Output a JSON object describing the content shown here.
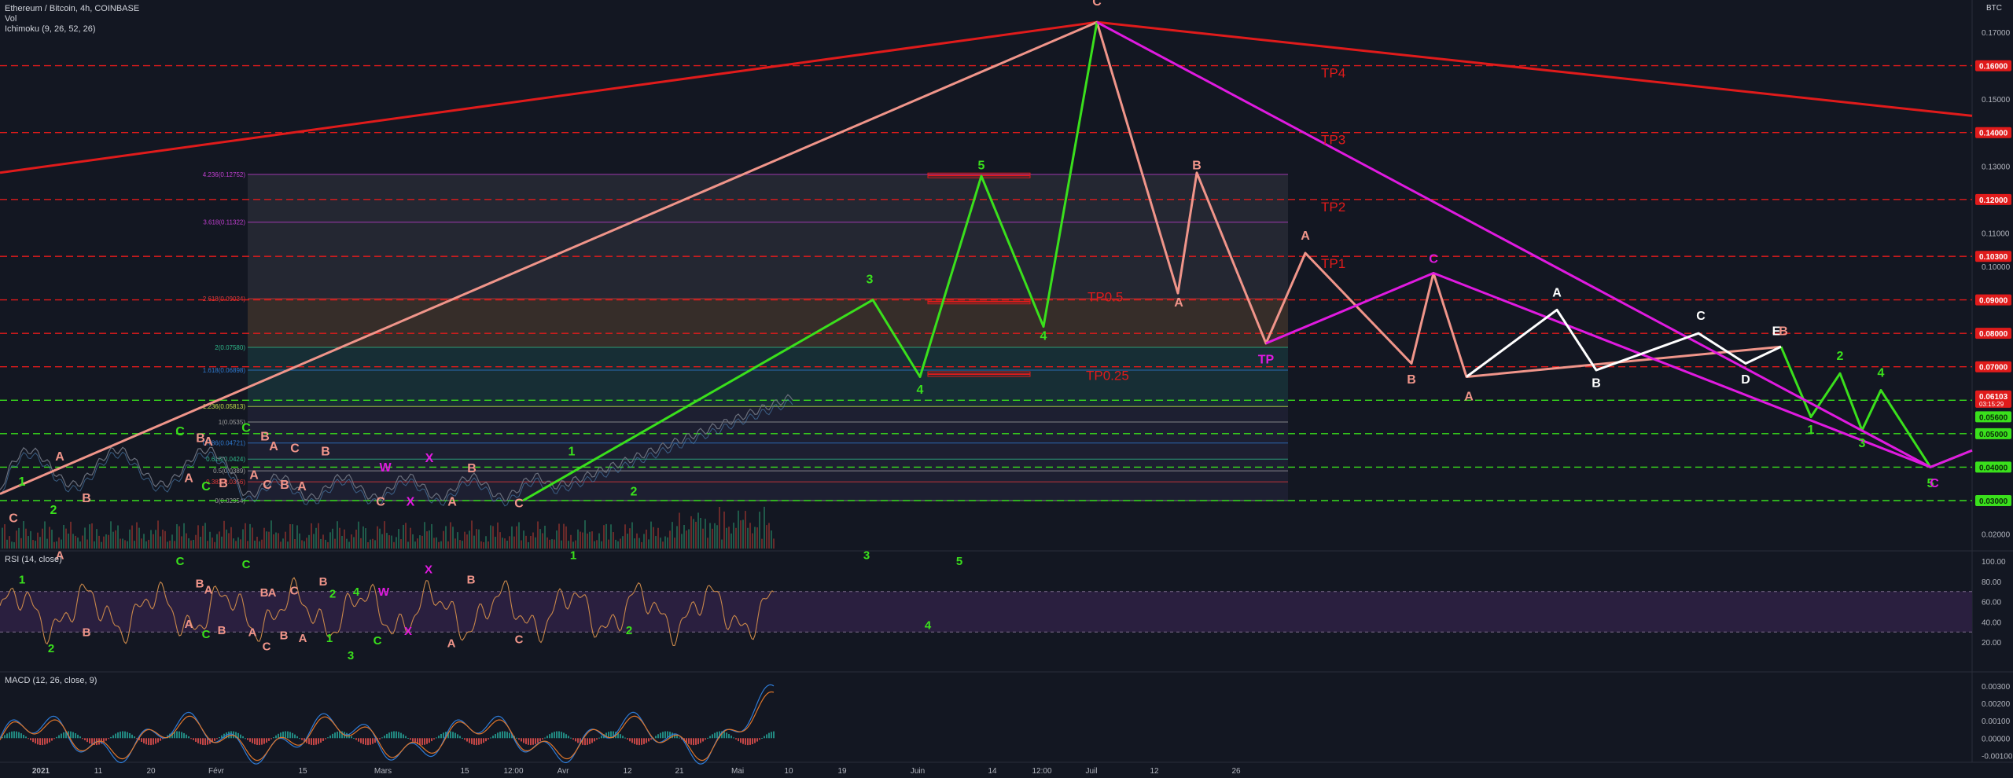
{
  "header": {
    "symbol_line": "Ethereum / Bitcoin, 4h, COINBASE",
    "vol_label": "Vol",
    "ichimoku_label": "Ichimoku (9, 26, 52, 26)",
    "rsi_label": "RSI (14, close)",
    "macd_label": "MACD (12, 26, close, 9)",
    "currency": "BTC"
  },
  "colors": {
    "background": "#131722",
    "red": "#e01b1b",
    "salmon": "#f0958a",
    "green": "#3ae01c",
    "magenta": "#e01ae0",
    "white": "#ffffff",
    "orange_rsi": "#c8874a",
    "macd_blue": "#2e7bd6",
    "macd_orange": "#e0762a"
  },
  "chart_data": {
    "type": "line",
    "title": "Ethereum / Bitcoin, 4h, COINBASE",
    "y_axis": {
      "min": 0.015,
      "max": 0.18,
      "ticks": [
        {
          "v": 0.17,
          "t": "0.17000"
        },
        {
          "v": 0.15,
          "t": "0.15000"
        },
        {
          "v": 0.13,
          "t": "0.13000"
        },
        {
          "v": 0.11,
          "t": "0.11000"
        },
        {
          "v": 0.1,
          "t": "0.10000"
        },
        {
          "v": 0.06,
          "t": "0.06000"
        },
        {
          "v": 0.03,
          "t": "0.03000"
        },
        {
          "v": 0.02,
          "t": "0.02000"
        }
      ],
      "highlighted": [
        {
          "v": 0.16,
          "t": "0.16000",
          "color": "red"
        },
        {
          "v": 0.14,
          "t": "0.14000",
          "color": "red"
        },
        {
          "v": 0.12,
          "t": "0.12000",
          "color": "red"
        },
        {
          "v": 0.103,
          "t": "0.10300",
          "color": "red"
        },
        {
          "v": 0.09,
          "t": "0.09000",
          "color": "red"
        },
        {
          "v": 0.08,
          "t": "0.08000",
          "color": "red"
        },
        {
          "v": 0.07,
          "t": "0.07000",
          "color": "red"
        },
        {
          "v": 0.05,
          "t": "0.05000",
          "color": "green"
        },
        {
          "v": 0.04,
          "t": "0.04000",
          "color": "green"
        },
        {
          "v": 0.03,
          "t": "0.03000",
          "color": "green"
        }
      ],
      "last_price": {
        "v": 0.06103,
        "t": "0.06103",
        "sub": "03:15:29"
      },
      "green_price": {
        "v": 0.056,
        "t": "0.05600"
      }
    },
    "x_ticks": [
      "2021",
      "11",
      "20",
      "Févr",
      "15",
      "Mars",
      "15",
      "12:00",
      "Avr",
      "12",
      "21",
      "Mai",
      "10",
      "19",
      "Juin",
      "14",
      "12:00",
      "Juil",
      "12",
      "26"
    ],
    "horizontal_levels": [
      {
        "v": 0.16,
        "color": "red",
        "style": "dashed"
      },
      {
        "v": 0.14,
        "color": "red",
        "style": "dashed"
      },
      {
        "v": 0.12,
        "color": "red",
        "style": "dashed"
      },
      {
        "v": 0.103,
        "color": "red",
        "style": "dashed"
      },
      {
        "v": 0.09,
        "color": "red",
        "style": "dashed"
      },
      {
        "v": 0.08,
        "color": "red",
        "style": "dashed"
      },
      {
        "v": 0.07,
        "color": "red",
        "style": "dashed"
      },
      {
        "v": 0.06,
        "color": "green",
        "style": "dashed"
      },
      {
        "v": 0.05,
        "color": "green",
        "style": "dashed"
      },
      {
        "v": 0.04,
        "color": "green",
        "style": "dashed"
      },
      {
        "v": 0.03,
        "color": "green",
        "style": "dashed"
      }
    ],
    "fib_levels": [
      {
        "v": 0.12752,
        "t": "4.236(0.12752)",
        "color": "#c03fd0"
      },
      {
        "v": 0.11322,
        "t": "3.618(0.11322)",
        "color": "#c03fd0"
      },
      {
        "v": 0.09034,
        "t": "2.618(0.09034)",
        "color": "#e03a3a"
      },
      {
        "v": 0.0758,
        "t": "2(0.07580)",
        "color": "#2fb88a"
      },
      {
        "v": 0.06898,
        "t": "1.618(0.06898)",
        "color": "#2f7ad0"
      },
      {
        "v": 0.05813,
        "t": "1.236(0.05813)",
        "color": "#c0e04a"
      },
      {
        "v": 0.0535,
        "t": "1(0.0535)",
        "color": "#9e9e9e"
      },
      {
        "v": 0.04721,
        "t": "0.786(0.04721)",
        "color": "#2f7ad0"
      },
      {
        "v": 0.0424,
        "t": "0.618(0.0424)",
        "color": "#2fb88a"
      },
      {
        "v": 0.0389,
        "t": "0.5(0.0389)",
        "color": "#9e9e9e"
      },
      {
        "v": 0.0356,
        "t": "0.382(0.0356)",
        "color": "#e03a3a"
      },
      {
        "v": 0.03,
        "t": "0(0.02954)",
        "color": "#9e9e9e"
      }
    ],
    "tp_labels": [
      {
        "t": "TP4",
        "v": 0.1565
      },
      {
        "t": "TP3",
        "v": 0.1365
      },
      {
        "t": "TP2",
        "v": 0.1165
      },
      {
        "t": "TP1",
        "v": 0.0995
      },
      {
        "t": "TP0.5",
        "v": 0.0895
      },
      {
        "t": "TP0.25",
        "v": 0.066
      }
    ],
    "series": [
      {
        "color": "red",
        "points": [
          [
            0,
            0.128
          ],
          [
            1395,
            0.173
          ],
          [
            2508,
            0.145
          ]
        ]
      },
      {
        "color": "salmon",
        "points": [
          [
            0,
            0.032
          ],
          [
            1395,
            0.173
          ],
          [
            1498,
            0.092
          ],
          [
            1522,
            0.128
          ],
          [
            1610,
            0.077
          ],
          [
            1660,
            0.104
          ],
          [
            1795,
            0.071
          ],
          [
            1823,
            0.098
          ],
          [
            1865,
            0.067
          ],
          [
            2265,
            0.076
          ]
        ]
      },
      {
        "color": "green",
        "points": [
          [
            665,
            0.03
          ],
          [
            1110,
            0.09
          ],
          [
            1170,
            0.067
          ],
          [
            1248,
            0.127
          ],
          [
            1327,
            0.082
          ],
          [
            1395,
            0.173
          ]
        ]
      },
      {
        "color": "green",
        "points": [
          [
            2265,
            0.076
          ],
          [
            2303,
            0.055
          ],
          [
            2340,
            0.068
          ],
          [
            2368,
            0.051
          ],
          [
            2392,
            0.063
          ],
          [
            2455,
            0.04
          ],
          [
            2508,
            0.045
          ]
        ]
      },
      {
        "color": "magenta",
        "points": [
          [
            1395,
            0.173
          ],
          [
            2455,
            0.04
          ],
          [
            2508,
            0.045
          ]
        ]
      },
      {
        "color": "magenta",
        "points": [
          [
            1610,
            0.077
          ],
          [
            1823,
            0.098
          ],
          [
            2455,
            0.04
          ]
        ]
      },
      {
        "color": "white",
        "points": [
          [
            1865,
            0.067
          ],
          [
            1980,
            0.087
          ],
          [
            2030,
            0.069
          ],
          [
            2160,
            0.08
          ],
          [
            2220,
            0.071
          ],
          [
            2265,
            0.076
          ]
        ]
      }
    ],
    "wave_labels": [
      {
        "t": "C",
        "x": 1395,
        "v": 0.178,
        "color": "salmon"
      },
      {
        "t": "5",
        "x": 1248,
        "v": 0.129,
        "color": "green"
      },
      {
        "t": "B",
        "x": 1522,
        "v": 0.129,
        "color": "salmon"
      },
      {
        "t": "A",
        "x": 1499,
        "v": 0.088,
        "color": "salmon"
      },
      {
        "t": "3",
        "x": 1106,
        "v": 0.095,
        "color": "green"
      },
      {
        "t": "4",
        "x": 1327,
        "v": 0.078,
        "color": "green"
      },
      {
        "t": "4",
        "x": 1170,
        "v": 0.062,
        "color": "green"
      },
      {
        "t": "TP",
        "x": 1610,
        "v": 0.071,
        "color": "magenta"
      },
      {
        "t": "A",
        "x": 1660,
        "v": 0.108,
        "color": "salmon"
      },
      {
        "t": "C",
        "x": 1823,
        "v": 0.101,
        "color": "magenta"
      },
      {
        "t": "B",
        "x": 1795,
        "v": 0.065,
        "color": "salmon"
      },
      {
        "t": "A",
        "x": 1868,
        "v": 0.06,
        "color": "salmon"
      },
      {
        "t": "A",
        "x": 1980,
        "v": 0.091,
        "color": "white"
      },
      {
        "t": "B",
        "x": 2030,
        "v": 0.064,
        "color": "white"
      },
      {
        "t": "C",
        "x": 2163,
        "v": 0.084,
        "color": "white"
      },
      {
        "t": "D",
        "x": 2220,
        "v": 0.065,
        "color": "white"
      },
      {
        "t": "E",
        "x": 2259,
        "v": 0.0795,
        "color": "white"
      },
      {
        "t": "B",
        "x": 2268,
        "v": 0.0795,
        "color": "salmon"
      },
      {
        "t": "2",
        "x": 2340,
        "v": 0.072,
        "color": "green"
      },
      {
        "t": "4",
        "x": 2392,
        "v": 0.067,
        "color": "green"
      },
      {
        "t": "1",
        "x": 2303,
        "v": 0.05,
        "color": "green"
      },
      {
        "t": "3",
        "x": 2368,
        "v": 0.046,
        "color": "green"
      },
      {
        "t": "5",
        "x": 2455,
        "v": 0.034,
        "color": "green"
      },
      {
        "t": "C",
        "x": 2460,
        "v": 0.034,
        "color": "magenta"
      },
      {
        "t": "1",
        "x": 28,
        "v": 0.0345,
        "color": "green"
      },
      {
        "t": "2",
        "x": 68,
        "v": 0.026,
        "color": "green"
      },
      {
        "t": "A",
        "x": 76,
        "v": 0.042,
        "color": "salmon"
      },
      {
        "t": "B",
        "x": 110,
        "v": 0.0295,
        "color": "salmon"
      },
      {
        "t": "C",
        "x": 17,
        "v": 0.0235,
        "color": "salmon"
      },
      {
        "t": "C",
        "x": 229,
        "v": 0.0495,
        "color": "green"
      },
      {
        "t": "B",
        "x": 255,
        "v": 0.0475,
        "color": "salmon"
      },
      {
        "t": "A",
        "x": 265,
        "v": 0.0465,
        "color": "salmon"
      },
      {
        "t": "A",
        "x": 240,
        "v": 0.0355,
        "color": "salmon"
      },
      {
        "t": "B",
        "x": 284,
        "v": 0.034,
        "color": "salmon"
      },
      {
        "t": "C",
        "x": 262,
        "v": 0.033,
        "color": "green"
      },
      {
        "t": "C",
        "x": 313,
        "v": 0.0505,
        "color": "green"
      },
      {
        "t": "B",
        "x": 337,
        "v": 0.048,
        "color": "salmon"
      },
      {
        "t": "A",
        "x": 348,
        "v": 0.045,
        "color": "salmon"
      },
      {
        "t": "C",
        "x": 375,
        "v": 0.0445,
        "color": "salmon"
      },
      {
        "t": "B",
        "x": 414,
        "v": 0.0435,
        "color": "salmon"
      },
      {
        "t": "A",
        "x": 323,
        "v": 0.0365,
        "color": "salmon"
      },
      {
        "t": "C",
        "x": 340,
        "v": 0.0335,
        "color": "salmon"
      },
      {
        "t": "B",
        "x": 362,
        "v": 0.0335,
        "color": "salmon"
      },
      {
        "t": "A",
        "x": 384,
        "v": 0.033,
        "color": "salmon"
      },
      {
        "t": "W",
        "x": 490,
        "v": 0.0387,
        "color": "magenta"
      },
      {
        "t": "X",
        "x": 546,
        "v": 0.0415,
        "color": "magenta"
      },
      {
        "t": "C",
        "x": 484,
        "v": 0.0285,
        "color": "salmon"
      },
      {
        "t": "X",
        "x": 522,
        "v": 0.0285,
        "color": "magenta"
      },
      {
        "t": "A",
        "x": 575,
        "v": 0.0285,
        "color": "salmon"
      },
      {
        "t": "B",
        "x": 600,
        "v": 0.0385,
        "color": "salmon"
      },
      {
        "t": "C",
        "x": 660,
        "v": 0.028,
        "color": "salmon"
      },
      {
        "t": "1",
        "x": 727,
        "v": 0.0435,
        "color": "green"
      },
      {
        "t": "2",
        "x": 806,
        "v": 0.0315,
        "color": "green"
      }
    ],
    "rsi": {
      "ylim": [
        0,
        100
      ],
      "ticks": [
        {
          "v": 100,
          "t": "100.00"
        },
        {
          "v": 80,
          "t": "80.00"
        },
        {
          "v": 60,
          "t": "60.00"
        },
        {
          "v": 40,
          "t": "40.00"
        },
        {
          "v": 20,
          "t": "20.00"
        }
      ],
      "band": [
        30,
        70
      ],
      "labels": [
        {
          "t": "A",
          "x": 76,
          "v": 102,
          "color": "salmon"
        },
        {
          "t": "1",
          "x": 28,
          "v": 78,
          "color": "green"
        },
        {
          "t": "2",
          "x": 65,
          "v": 10,
          "color": "green"
        },
        {
          "t": "B",
          "x": 110,
          "v": 26,
          "color": "salmon"
        },
        {
          "t": "C",
          "x": 229,
          "v": 96,
          "color": "green"
        },
        {
          "t": "C",
          "x": 313,
          "v": 93,
          "color": "green"
        },
        {
          "t": "B",
          "x": 254,
          "v": 74,
          "color": "salmon"
        },
        {
          "t": "A",
          "x": 265,
          "v": 68,
          "color": "salmon"
        },
        {
          "t": "A",
          "x": 240,
          "v": 34,
          "color": "salmon"
        },
        {
          "t": "C",
          "x": 262,
          "v": 24,
          "color": "green"
        },
        {
          "t": "B",
          "x": 282,
          "v": 28,
          "color": "salmon"
        },
        {
          "t": "B",
          "x": 336,
          "v": 65,
          "color": "salmon"
        },
        {
          "t": "A",
          "x": 346,
          "v": 65,
          "color": "salmon"
        },
        {
          "t": "C",
          "x": 374,
          "v": 67,
          "color": "salmon"
        },
        {
          "t": "B",
          "x": 411,
          "v": 76,
          "color": "salmon"
        },
        {
          "t": "2",
          "x": 423,
          "v": 64,
          "color": "green"
        },
        {
          "t": "4",
          "x": 453,
          "v": 66,
          "color": "green"
        },
        {
          "t": "A",
          "x": 321,
          "v": 26,
          "color": "salmon"
        },
        {
          "t": "C",
          "x": 339,
          "v": 12,
          "color": "salmon"
        },
        {
          "t": "B",
          "x": 361,
          "v": 23,
          "color": "salmon"
        },
        {
          "t": "A",
          "x": 385,
          "v": 20,
          "color": "salmon"
        },
        {
          "t": "1",
          "x": 419,
          "v": 20,
          "color": "green"
        },
        {
          "t": "3",
          "x": 446,
          "v": 3,
          "color": "green"
        },
        {
          "t": "W",
          "x": 488,
          "v": 66,
          "color": "magenta"
        },
        {
          "t": "X",
          "x": 545,
          "v": 88,
          "color": "magenta"
        },
        {
          "t": "B",
          "x": 599,
          "v": 78,
          "color": "salmon"
        },
        {
          "t": "C",
          "x": 480,
          "v": 18,
          "color": "green"
        },
        {
          "t": "X",
          "x": 519,
          "v": 27,
          "color": "magenta"
        },
        {
          "t": "A",
          "x": 574,
          "v": 15,
          "color": "salmon"
        },
        {
          "t": "C",
          "x": 660,
          "v": 19,
          "color": "salmon"
        },
        {
          "t": "1",
          "x": 729,
          "v": 102,
          "color": "green"
        },
        {
          "t": "2",
          "x": 800,
          "v": 28,
          "color": "green"
        },
        {
          "t": "3",
          "x": 1102,
          "v": 102,
          "color": "green"
        },
        {
          "t": "5",
          "x": 1220,
          "v": 96,
          "color": "green"
        },
        {
          "t": "4",
          "x": 1180,
          "v": 33,
          "color": "green"
        }
      ]
    },
    "macd": {
      "ticks": [
        {
          "v": 0.003,
          "t": "0.00300"
        },
        {
          "v": 0.002,
          "t": "0.00200"
        },
        {
          "v": 0.001,
          "t": "0.00100"
        },
        {
          "v": 0.0,
          "t": "0.00000"
        },
        {
          "v": -0.001,
          "t": "-0.00100"
        }
      ]
    }
  }
}
